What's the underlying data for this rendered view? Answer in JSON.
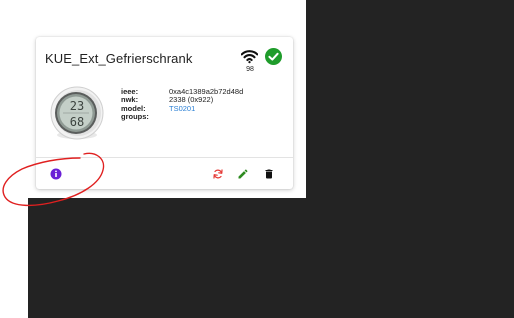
{
  "card": {
    "title": "KUE_Ext_Gefrierschrank",
    "signal_strength": "98",
    "status": "online",
    "info": [
      {
        "label": "ieee:",
        "value": "0xa4c1389a2b72d48d",
        "link": false
      },
      {
        "label": "nwk:",
        "value": "2338 (0x922)",
        "link": false
      },
      {
        "label": "model:",
        "value": "TS0201",
        "link": true
      },
      {
        "label": "groups:",
        "value": "",
        "link": false
      }
    ],
    "device_display": {
      "top": "23",
      "bottom": "68"
    },
    "actions": [
      "info-icon",
      "reconfigure-icon",
      "edit-icon",
      "delete-icon"
    ]
  },
  "colors": {
    "info": "#6a1fd6",
    "reconfigure": "#e53935",
    "edit": "#2e8b20",
    "delete": "#111111",
    "status_ok": "#1f9c2b",
    "link": "#2a7fd4",
    "annotation": "#e02020",
    "dark_background": "#232323"
  }
}
